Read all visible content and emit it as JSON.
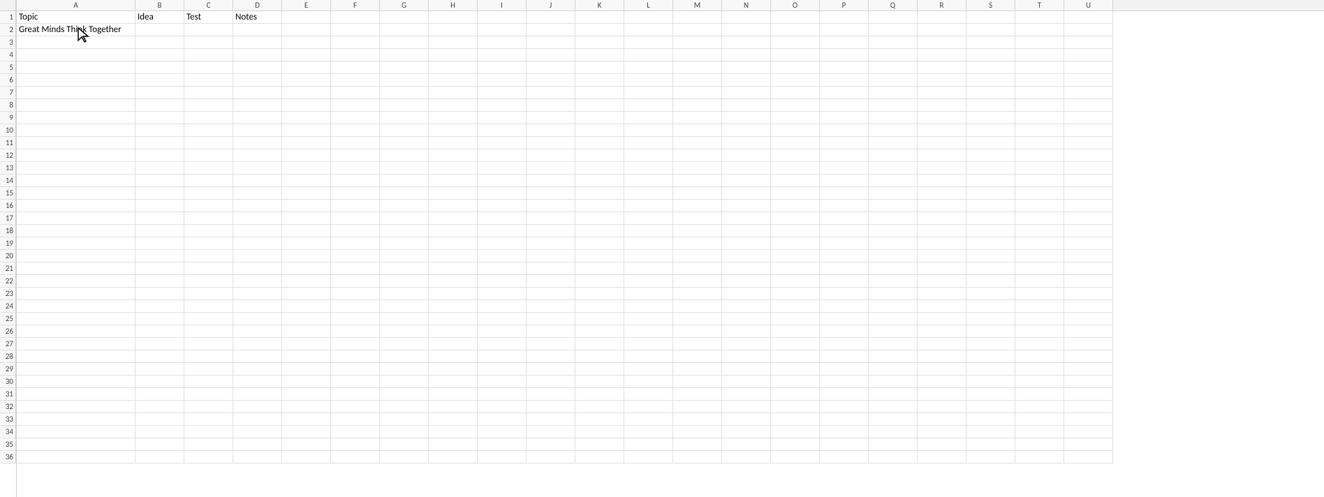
{
  "columns": [
    {
      "label": "A",
      "class": "col-a"
    },
    {
      "label": "B",
      "class": "col-b"
    },
    {
      "label": "C",
      "class": "col-c"
    },
    {
      "label": "D",
      "class": "col-d"
    },
    {
      "label": "E",
      "class": "col-e"
    },
    {
      "label": "F",
      "class": "col-f"
    },
    {
      "label": "G",
      "class": "col-g"
    },
    {
      "label": "H",
      "class": "col-h"
    },
    {
      "label": "I",
      "class": "col-i"
    },
    {
      "label": "J",
      "class": "col-j"
    },
    {
      "label": "K",
      "class": "col-k"
    },
    {
      "label": "L",
      "class": "col-l"
    },
    {
      "label": "M",
      "class": "col-m"
    },
    {
      "label": "N",
      "class": "col-n"
    },
    {
      "label": "O",
      "class": "col-o"
    },
    {
      "label": "P",
      "class": "col-p"
    },
    {
      "label": "Q",
      "class": "col-q"
    },
    {
      "label": "R",
      "class": "col-r"
    },
    {
      "label": "S",
      "class": "col-s"
    },
    {
      "label": "T",
      "class": "col-t"
    },
    {
      "label": "U",
      "class": "col-u"
    }
  ],
  "rows": 36,
  "cells": {
    "1": {
      "A": "Topic",
      "B": "Idea",
      "C": "Test",
      "D": "Notes"
    },
    "2": {
      "A": "Great Minds Think Together"
    }
  }
}
